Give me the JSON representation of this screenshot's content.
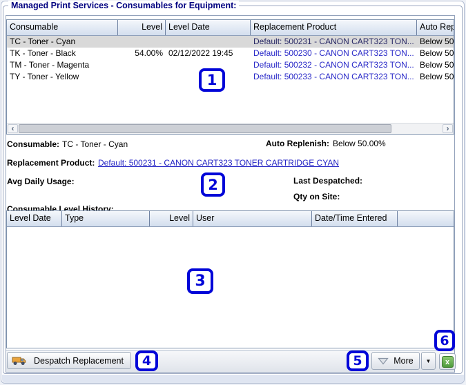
{
  "legend": "Managed Print Services - Consumables for Equipment:",
  "colors": {
    "accent_navy": "#000080",
    "link_blue": "#2222c4",
    "badge_blue": "#0105d8",
    "selected_row_gray": "#d9d9d9",
    "excel_green": "#4e9a3c"
  },
  "consumables_table": {
    "columns": [
      "Consumable",
      "Level",
      "Level Date",
      "Replacement Product",
      "Auto Rep"
    ],
    "rows": [
      {
        "consumable": "TC - Toner - Cyan",
        "level": "",
        "level_date": "",
        "replacement": "Default: 500231 - CANON CART323 TON...",
        "auto_rep": "Below 50."
      },
      {
        "consumable": "TK - Toner - Black",
        "level": "54.00%",
        "level_date": "02/12/2022 19:45",
        "replacement": "Default: 500230 - CANON CART323 TON...",
        "auto_rep": "Below 50."
      },
      {
        "consumable": "TM - Toner - Magenta",
        "level": "",
        "level_date": "",
        "replacement": "Default: 500232 - CANON CART323 TON...",
        "auto_rep": "Below 50."
      },
      {
        "consumable": "TY - Toner - Yellow",
        "level": "",
        "level_date": "",
        "replacement": "Default: 500233 - CANON CART323 TON...",
        "auto_rep": "Below 50."
      }
    ]
  },
  "details": {
    "consumable_label": "Consumable:",
    "consumable_value": "TC - Toner - Cyan",
    "auto_replenish_label": "Auto Replenish:",
    "auto_replenish_value": "Below 50.00%",
    "replacement_label": "Replacement Product:",
    "replacement_link": "Default: 500231 - CANON CART323 TONER CARTRIDGE CYAN",
    "avg_daily_usage_label": "Avg Daily Usage:",
    "last_despatched_label": "Last Despatched:",
    "qty_on_site_label": "Qty on Site:"
  },
  "history_table": {
    "title": "Consumable Level History:",
    "columns": [
      "Level Date",
      "Type",
      "Level",
      "User",
      "Date/Time Entered"
    ]
  },
  "toolbar": {
    "despatch_label": "Despatch Replacement",
    "more_label": "More",
    "dropdown_glyph": "▼",
    "excel_glyph": "x"
  },
  "scrollbar": {
    "left_glyph": "‹",
    "right_glyph": "›"
  },
  "annotations": [
    "1",
    "2",
    "3",
    "4",
    "5",
    "6"
  ]
}
